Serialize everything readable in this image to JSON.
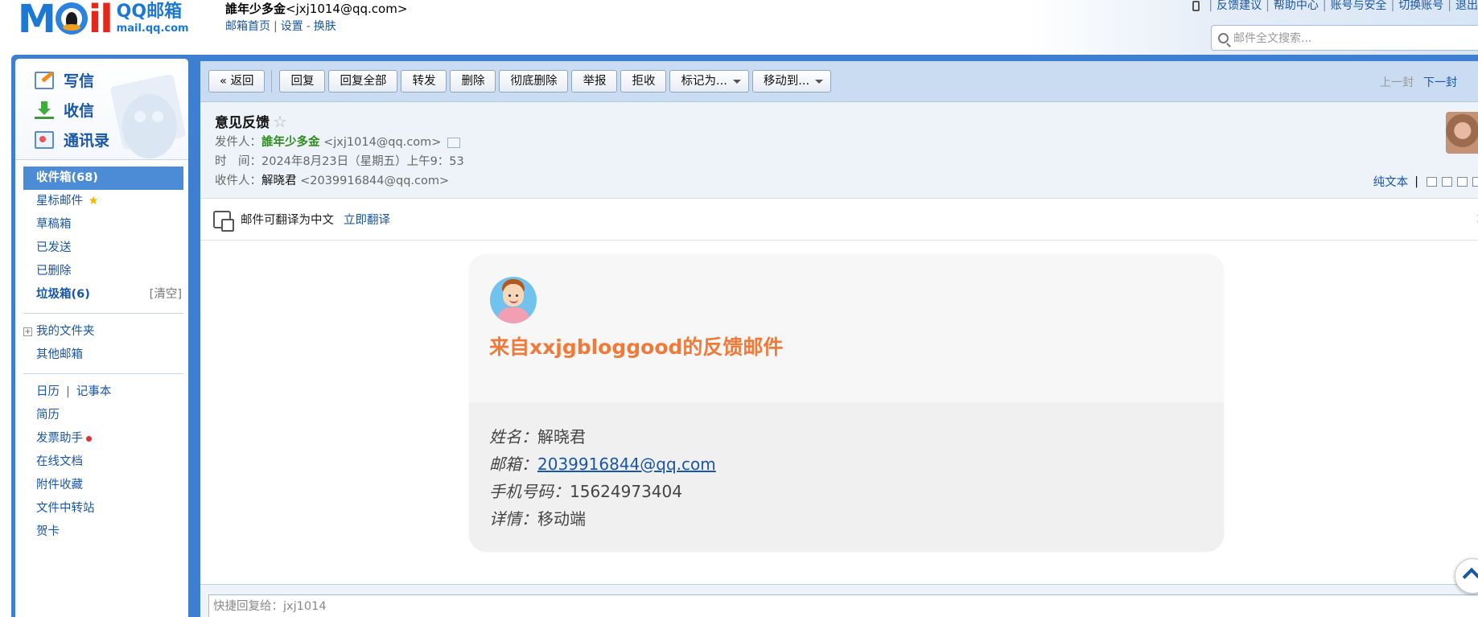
{
  "header": {
    "logo_mail": "MAIL",
    "logo_title": "QQ邮箱",
    "logo_domain": "mail.qq.com",
    "user_name": "誰年少多金",
    "user_email": "<jxj1014@qq.com>",
    "links": [
      "邮箱首页",
      "设置",
      "换肤"
    ],
    "top_links": [
      "反馈建议",
      "帮助中心",
      "账号与安全",
      "切换账号",
      "退出"
    ],
    "search_placeholder": "邮件全文搜索..."
  },
  "sidebar": {
    "compose": "写信",
    "inbox": "收信",
    "contacts": "通讯录",
    "folders": [
      {
        "label": "收件箱(68)"
      },
      {
        "label": "星标邮件"
      },
      {
        "label": "草稿箱"
      },
      {
        "label": "已发送"
      },
      {
        "label": "已删除"
      },
      {
        "label": "垃圾箱(6)",
        "action": "[清空]"
      }
    ],
    "my_folders": "我的文件夹",
    "other_mailbox": "其他邮箱",
    "calendar": "日历",
    "notepad": "记事本",
    "tools": [
      "简历",
      "发票助手",
      "在线文档",
      "附件收藏",
      "文件中转站",
      "贺卡"
    ]
  },
  "toolbar": {
    "back": "« 返回",
    "reply": "回复",
    "reply_all": "回复全部",
    "forward": "转发",
    "delete": "删除",
    "delete_forever": "彻底删除",
    "report": "举报",
    "reject": "拒收",
    "mark_as": "标记为...",
    "move_to": "移动到...",
    "prev": "上一封",
    "next": "下一封"
  },
  "mail": {
    "subject": "意见反馈",
    "from_label": "发件人：",
    "from_name": "誰年少多金",
    "from_addr": "<jxj1014@qq.com>",
    "time_label": "时　间：",
    "time_value": "2024年8月23日（星期五）上午9：53",
    "to_label": "收件人：",
    "to_name": "解晓君",
    "to_addr": "<2039916844@qq.com>",
    "plain_text": "纯文本"
  },
  "translate": {
    "text": "邮件可翻译为中文",
    "action": "立即翻译"
  },
  "card": {
    "title": "来自xxjgbloggood的反馈邮件",
    "name_label": "姓名：",
    "name_value": "解晓君",
    "email_label": "邮箱：",
    "email_value": "2039916844@qq.com",
    "phone_label": "手机号码：",
    "phone_value": "15624973404",
    "detail_label": "详情：",
    "detail_value": "移动端"
  },
  "quick_reply": {
    "placeholder": "快捷回复给：jxj1014"
  }
}
